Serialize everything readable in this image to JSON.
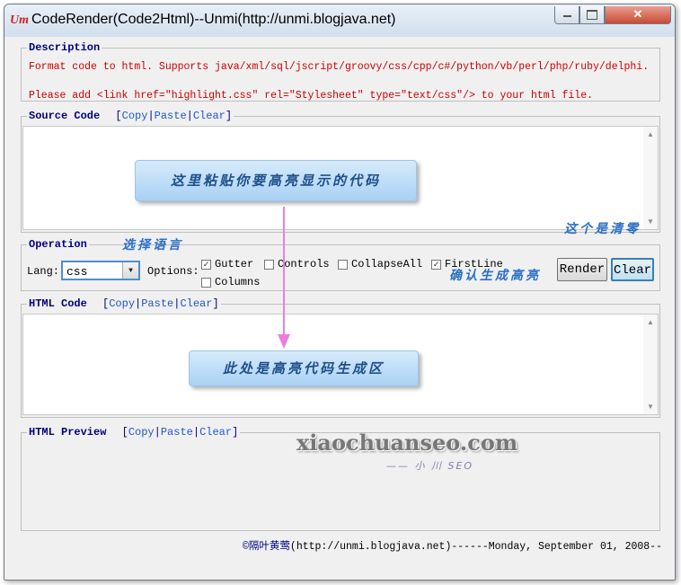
{
  "window": {
    "app_icon": "Um",
    "title": "CodeRender(Code2Html)--Unmi(http://unmi.blogjava.net)",
    "close_glyph": "✕"
  },
  "description": {
    "legend": "Description",
    "line1": "Format code to html. Supports java/xml/sql/jscript/groovy/css/cpp/c#/python/vb/perl/php/ruby/delphi.",
    "line2": "Please add <link href=\"highlight.css\" rel=\"Stylesheet\" type=\"text/css\"/> to your html file."
  },
  "source_code": {
    "legend": "Source Code",
    "links": {
      "copy": "Copy",
      "paste": "Paste",
      "clear": "Clear"
    },
    "callout": "这里粘贴你要高亮显示的代码"
  },
  "operation": {
    "legend": "Operation",
    "lang_label": "Lang:",
    "lang_value": "css",
    "options_label": "Options:",
    "options": [
      {
        "label": "Gutter",
        "checked": true
      },
      {
        "label": "Controls",
        "checked": false
      },
      {
        "label": "CollapseAll",
        "checked": false
      },
      {
        "label": "FirstLine",
        "checked": true
      },
      {
        "label": "Columns",
        "checked": false
      }
    ],
    "render_label": "Render",
    "clear_label": "Clear",
    "anno_lang": "选择语言",
    "anno_render": "确认生成高亮",
    "anno_clear": "这个是清零"
  },
  "html_code": {
    "legend": "HTML Code",
    "links": {
      "copy": "Copy",
      "paste": "Paste",
      "clear": "Clear"
    },
    "callout": "此处是高亮代码生成区"
  },
  "html_preview": {
    "legend": "HTML Preview",
    "links": {
      "copy": "Copy",
      "paste": "Paste",
      "clear": "Clear"
    }
  },
  "watermark": {
    "main": "xiaochuanseo.com",
    "sub": "—— 小 川 SEO"
  },
  "footer": {
    "author": "©隔叶黄莺",
    "rest": "(http://unmi.blogjava.net)------Monday, September 01, 2008--"
  },
  "colors": {
    "accent": "#000080",
    "link": "#2255cc",
    "warning_text": "#cc0000",
    "callout": "#a9d1f4"
  }
}
